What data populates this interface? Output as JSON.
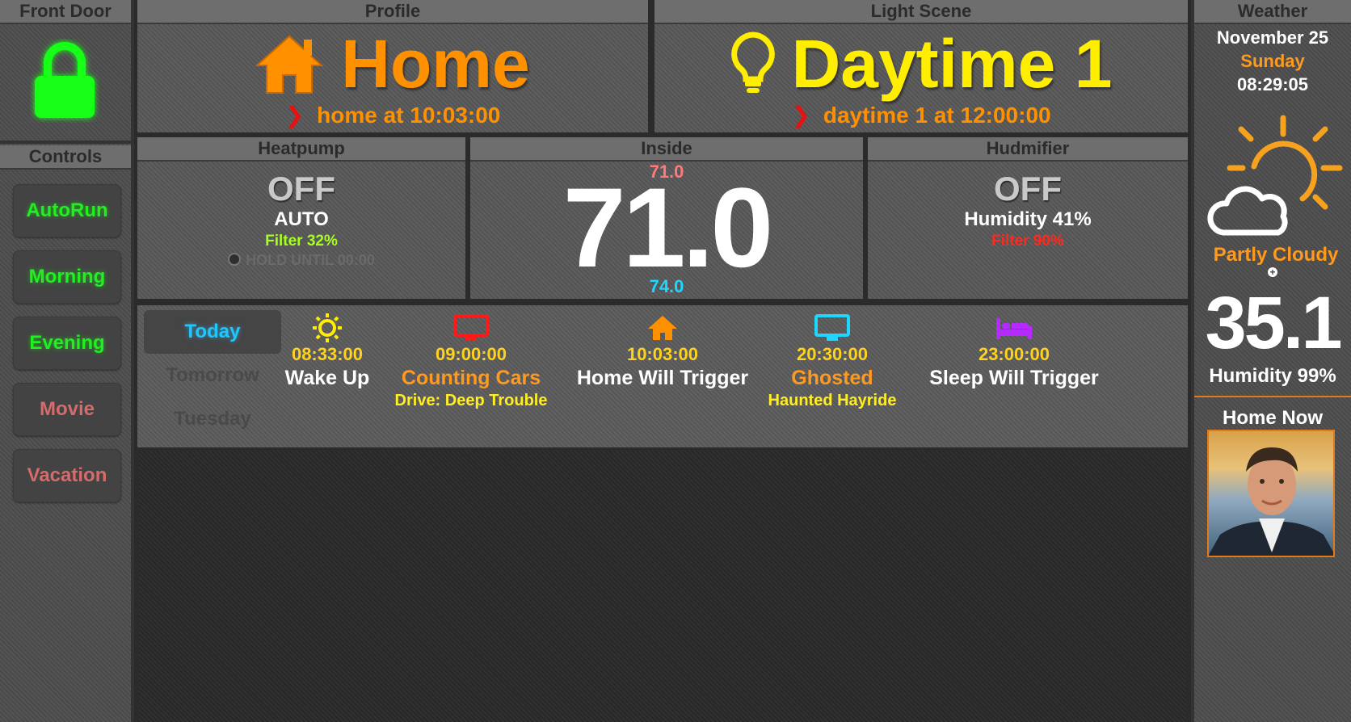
{
  "front_door": {
    "title": "Front Door",
    "lock_state_icon": "lock-locked",
    "color": "#18ff18"
  },
  "controls": {
    "title": "Controls",
    "buttons": [
      {
        "label": "AutoRun",
        "color": "#22ee22"
      },
      {
        "label": "Morning",
        "color": "#22ee22"
      },
      {
        "label": "Evening",
        "color": "#22ee22"
      },
      {
        "label": "Movie",
        "color": "#d56b6b"
      },
      {
        "label": "Vacation",
        "color": "#d56b6b"
      }
    ]
  },
  "profile": {
    "title": "Profile",
    "value": "Home",
    "icon": "house-icon",
    "next": "home at 10:03:00",
    "color": "#ff9100"
  },
  "light_scene": {
    "title": "Light Scene",
    "value": "Daytime 1",
    "icon": "lightbulb-icon",
    "next": "daytime 1 at 12:00:00",
    "color": "#ffee00"
  },
  "heatpump": {
    "title": "Heatpump",
    "state": "OFF",
    "mode": "AUTO",
    "filter": "Filter 32%",
    "hold": "HOLD UNTIL 00:00"
  },
  "inside": {
    "title": "Inside",
    "temperature": "71.0",
    "heat_setpoint": "71.0",
    "cool_setpoint": "74.0"
  },
  "humidifier": {
    "title": "Hudmifier",
    "state": "OFF",
    "humidity": "Humidity 41%",
    "filter": "Filter 90%"
  },
  "schedule": {
    "days": [
      "Today",
      "Tomorrow",
      "Tuesday"
    ],
    "events": [
      {
        "icon": "sun-icon",
        "time": "08:33:00",
        "name": "Wake Up",
        "sub": "",
        "name_color": "#ffffff"
      },
      {
        "icon": "tv-icon",
        "time": "09:00:00",
        "name": "Counting Cars",
        "sub": "Drive: Deep Trouble",
        "name_color": "#ff9a1f"
      },
      {
        "icon": "house-icon",
        "time": "10:03:00",
        "name": "Home Will Trigger",
        "sub": "",
        "name_color": "#ffffff"
      },
      {
        "icon": "tv-icon",
        "time": "20:30:00",
        "name": "Ghosted",
        "sub": "Haunted Hayride",
        "name_color": "#ff9a1f"
      },
      {
        "icon": "bed-icon",
        "time": "23:00:00",
        "name": "Sleep Will Trigger",
        "sub": "",
        "name_color": "#ffffff"
      }
    ]
  },
  "weather": {
    "title": "Weather",
    "date": "November 25",
    "weekday": "Sunday",
    "time": "08:29:05",
    "condition": "Partly Cloudy",
    "temperature": "35.1",
    "humidity": "Humidity 99%"
  },
  "home_now": {
    "title": "Home Now"
  }
}
